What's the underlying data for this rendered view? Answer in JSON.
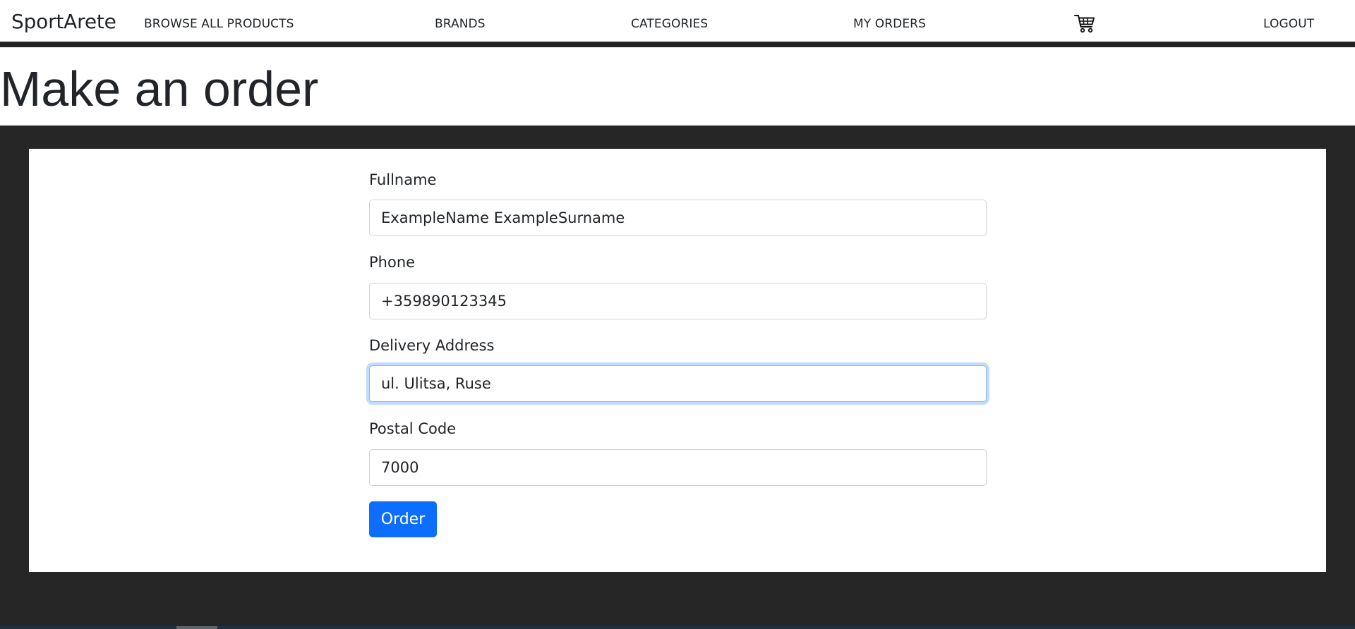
{
  "navbar": {
    "brand": "SportArete",
    "links": {
      "browse": "BROWSE ALL PRODUCTS",
      "brands": "BRANDS",
      "categories": "CATEGORIES",
      "my_orders": "MY ORDERS",
      "logout": "LOGOUT"
    },
    "cart_icon": "shopping-cart-icon"
  },
  "page": {
    "title": "Make an order"
  },
  "form": {
    "fullname": {
      "label": "Fullname",
      "value": "ExampleName ExampleSurname"
    },
    "phone": {
      "label": "Phone",
      "value": "+359890123345"
    },
    "address": {
      "label": "Delivery Address",
      "value": "ul. Ulitsa, Ruse"
    },
    "postal": {
      "label": "Postal Code",
      "value": "7000"
    },
    "submit_label": "Order"
  },
  "colors": {
    "dark_background": "#262626",
    "primary_button": "#0d6efd",
    "focus_border": "#86b7fe"
  }
}
